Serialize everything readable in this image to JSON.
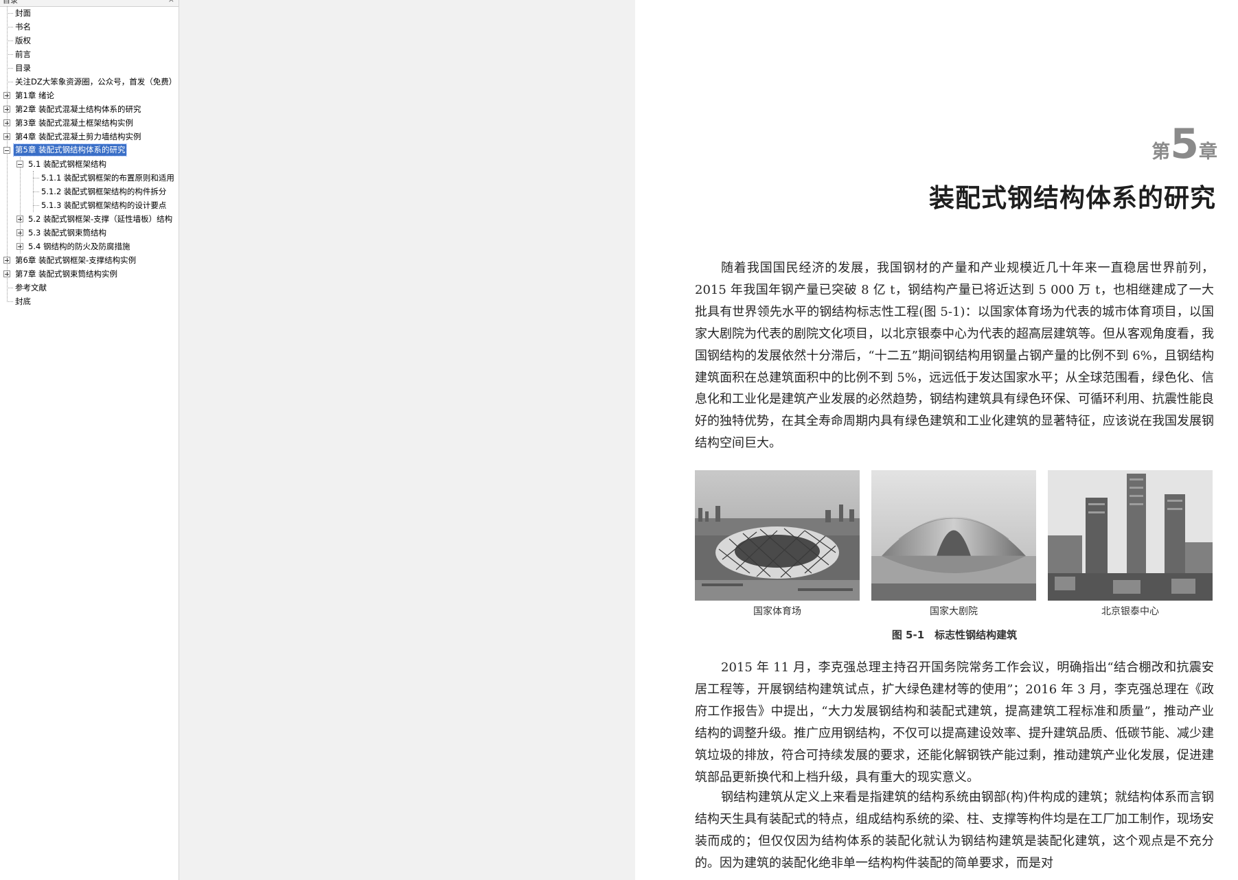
{
  "sidebar": {
    "title": "目录",
    "close_label": "×",
    "items": [
      {
        "label": "封面"
      },
      {
        "label": "书名"
      },
      {
        "label": "版权"
      },
      {
        "label": "前言"
      },
      {
        "label": "目录"
      },
      {
        "label": "关注DZ大笨象资源圈，公众号，首发（免费）"
      },
      {
        "label": "第1章 绪论"
      },
      {
        "label": "第2章 装配式混凝土结构体系的研究"
      },
      {
        "label": "第3章 装配式混凝土框架结构实例"
      },
      {
        "label": "第4章 装配式混凝土剪力墙结构实例"
      },
      {
        "label": "第5章 装配式钢结构体系的研究"
      },
      {
        "label": "5.1 装配式钢框架结构"
      },
      {
        "label": "5.1.1 装配式钢框架的布置原则和适用"
      },
      {
        "label": "5.1.2 装配式钢框架结构的构件拆分"
      },
      {
        "label": "5.1.3 装配式钢框架结构的设计要点"
      },
      {
        "label": "5.2 装配式钢框架-支撑（延性墙板）结构"
      },
      {
        "label": "5.3 装配式钢束筒结构"
      },
      {
        "label": "5.4 钢结构的防火及防腐措施"
      },
      {
        "label": "第6章 装配式钢框架-支撑结构实例"
      },
      {
        "label": "第7章 装配式钢束筒结构实例"
      },
      {
        "label": "参考文献"
      },
      {
        "label": "封底"
      }
    ]
  },
  "page": {
    "chapter_prefix": "第",
    "chapter_number": "5",
    "chapter_suffix": "章",
    "chapter_title": "装配式钢结构体系的研究",
    "paragraph1": "随着我国国民经济的发展，我国钢材的产量和产业规模近几十年来一直稳居世界前列，2015 年我国年钢产量已突破 8 亿 t，钢结构产量已将近达到 5 000 万 t，也相继建成了一大批具有世界领先水平的钢结构标志性工程(图 5-1)：以国家体育场为代表的城市体育项目，以国家大剧院为代表的剧院文化项目，以北京银泰中心为代表的超高层建筑等。但从客观角度看，我国钢结构的发展依然十分滞后，“十二五”期间钢结构用钢量占钢产量的比例不到 6%，且钢结构建筑面积在总建筑面积中的比例不到 5%，远远低于发达国家水平；从全球范围看，绿色化、信息化和工业化是建筑产业发展的必然趋势，钢结构建筑具有绿色环保、可循环利用、抗震性能良好的独特优势，在其全寿命周期内具有绿色建筑和工业化建筑的显著特征，应该说在我国发展钢结构空间巨大。",
    "figure": {
      "photos": [
        {
          "caption": "国家体育场"
        },
        {
          "caption": "国家大剧院"
        },
        {
          "caption": "北京银泰中心"
        }
      ],
      "caption": "图 5-1　标志性钢结构建筑"
    },
    "paragraph2": "2015 年 11 月，李克强总理主持召开国务院常务工作会议，明确指出“结合棚改和抗震安居工程等，开展钢结构建筑试点，扩大绿色建材等的使用”；2016 年 3 月，李克强总理在《政府工作报告》中提出，“大力发展钢结构和装配式建筑，提高建筑工程标准和质量”，推动产业结构的调整升级。推广应用钢结构，不仅可以提高建设效率、提升建筑品质、低碳节能、减少建筑垃圾的排放，符合可持续发展的要求，还能化解钢铁产能过剩，推动建筑产业化发展，促进建筑部品更新换代和上档升级，具有重大的现实意义。",
    "paragraph3": "钢结构建筑从定义上来看是指建筑的结构系统由钢部(构)件构成的建筑；就结构体系而言钢结构天生具有装配式的特点，组成结构系统的梁、柱、支撑等构件均是在工厂加工制作，现场安装而成的；但仅仅因为结构体系的装配化就认为钢结构建筑是装配化建筑，这个观点是不充分的。因为建筑的装配化绝非单一结构构件装配的简单要求，而是对"
  }
}
